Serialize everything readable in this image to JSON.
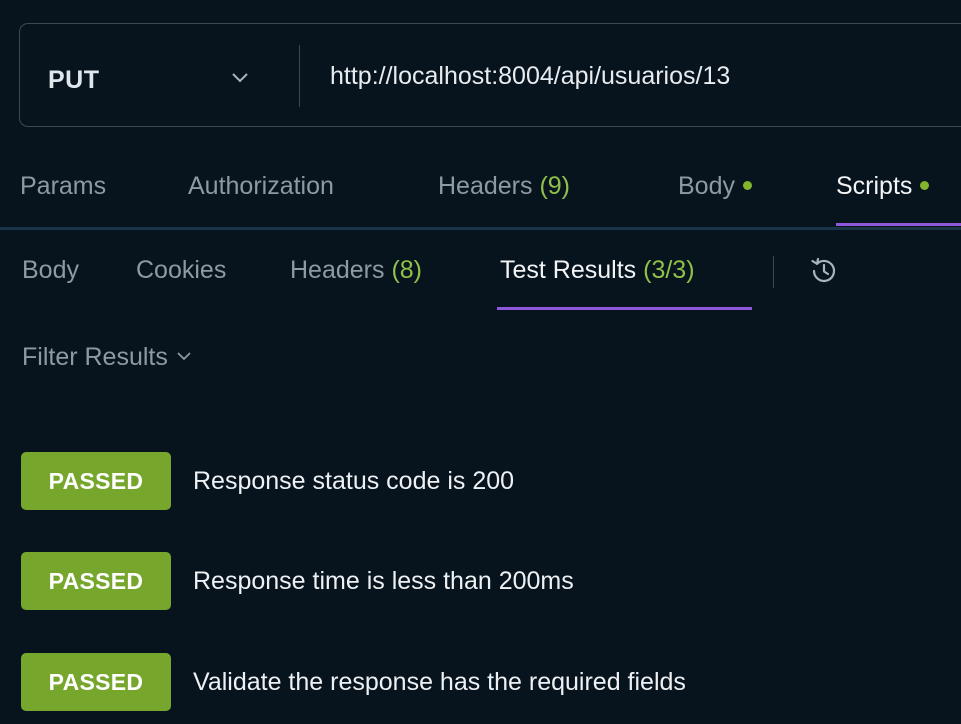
{
  "request": {
    "method": "PUT",
    "url": "http://localhost:8004/api/usuarios/13"
  },
  "request_tabs": [
    {
      "label": "Params",
      "count": null,
      "active": false
    },
    {
      "label": "Authorization",
      "count": null,
      "active": false
    },
    {
      "label": "Headers",
      "count": "(9)",
      "active": false
    },
    {
      "label": "Body",
      "count": null,
      "active": false,
      "has_dot": true
    },
    {
      "label": "Scripts",
      "count": null,
      "active": true,
      "has_dot": true
    }
  ],
  "response_tabs": [
    {
      "label": "Body",
      "count": null,
      "active": false
    },
    {
      "label": "Cookies",
      "count": null,
      "active": false
    },
    {
      "label": "Headers",
      "count": "(8)",
      "active": false
    },
    {
      "label": "Test Results",
      "count": "(3/3)",
      "active": true
    }
  ],
  "filter": {
    "label": "Filter Results"
  },
  "results": [
    {
      "status": "PASSED",
      "name": "Response status code is 200"
    },
    {
      "status": "PASSED",
      "name": "Response time is less than 200ms"
    },
    {
      "status": "PASSED",
      "name": "Validate the response has the required fields"
    }
  ],
  "icons": {
    "method_dropdown": "chevron-down-icon",
    "history": "history-icon",
    "filter_dropdown": "chevron-down-icon",
    "modified_indicator": "dot-icon"
  },
  "colors": {
    "background": "#07141e",
    "accent_underline": "#8f57d9",
    "count_green": "#8ec04a",
    "passed_badge": "#76a62c",
    "dot_green": "#82b52b"
  }
}
